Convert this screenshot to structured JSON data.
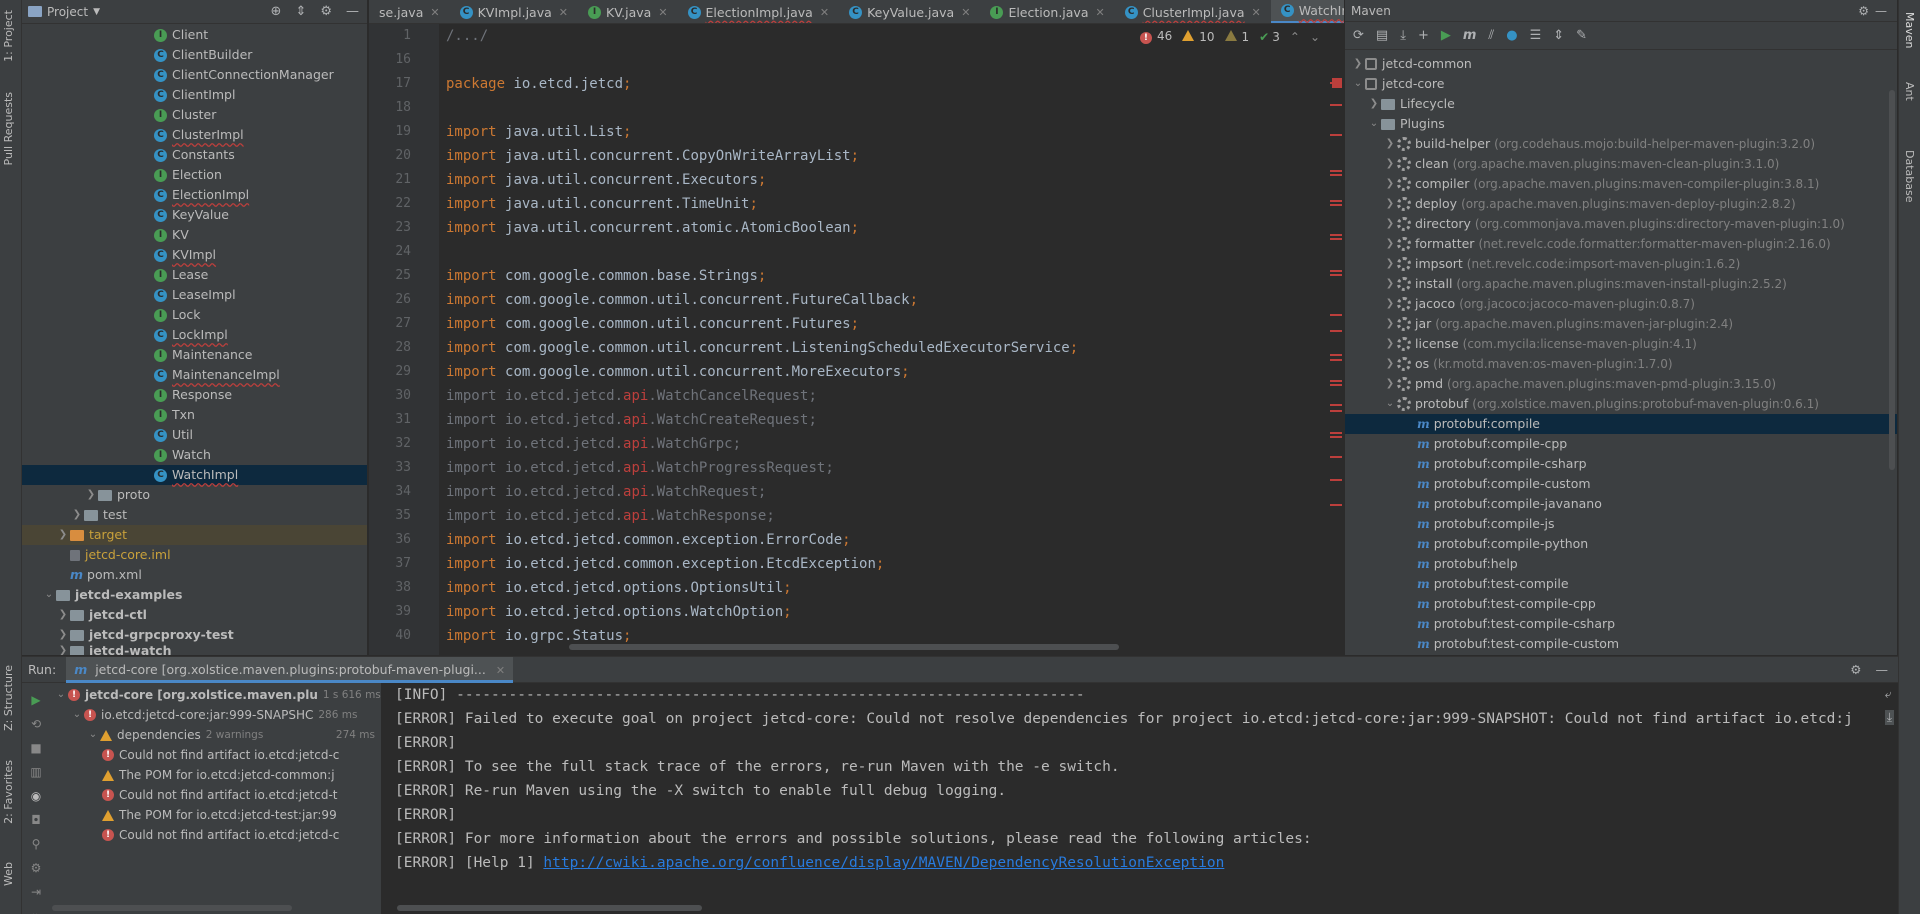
{
  "left_strip": {
    "project_tab": "1: Project",
    "pull_requests_tab": "Pull Requests",
    "structure_tab": "Z: Structure",
    "favorites_tab": "2: Favorites",
    "web_tab": "Web"
  },
  "project_panel": {
    "title": "Project",
    "classes": [
      {
        "name": "Client",
        "kind": "i",
        "error": false
      },
      {
        "name": "ClientBuilder",
        "kind": "c",
        "error": false
      },
      {
        "name": "ClientConnectionManager",
        "kind": "c",
        "error": false
      },
      {
        "name": "ClientImpl",
        "kind": "c",
        "error": false
      },
      {
        "name": "Cluster",
        "kind": "i",
        "error": false
      },
      {
        "name": "ClusterImpl",
        "kind": "c",
        "error": true
      },
      {
        "name": "Constants",
        "kind": "c",
        "error": false
      },
      {
        "name": "Election",
        "kind": "i",
        "error": false
      },
      {
        "name": "ElectionImpl",
        "kind": "c",
        "error": true
      },
      {
        "name": "KeyValue",
        "kind": "c",
        "error": false
      },
      {
        "name": "KV",
        "kind": "i",
        "error": false
      },
      {
        "name": "KVImpl",
        "kind": "c",
        "error": true
      },
      {
        "name": "Lease",
        "kind": "i",
        "error": false
      },
      {
        "name": "LeaseImpl",
        "kind": "c",
        "error": false
      },
      {
        "name": "Lock",
        "kind": "i",
        "error": false
      },
      {
        "name": "LockImpl",
        "kind": "c",
        "error": true
      },
      {
        "name": "Maintenance",
        "kind": "i",
        "error": false
      },
      {
        "name": "MaintenanceImpl",
        "kind": "c",
        "error": true
      },
      {
        "name": "Response",
        "kind": "i",
        "error": false
      },
      {
        "name": "Txn",
        "kind": "i",
        "error": false
      },
      {
        "name": "Util",
        "kind": "c",
        "error": false
      },
      {
        "name": "Watch",
        "kind": "i",
        "error": false
      },
      {
        "name": "WatchImpl",
        "kind": "c",
        "error": true
      }
    ],
    "proto": "proto",
    "test": "test",
    "target": "target",
    "iml": "jetcd-core.iml",
    "pom": "pom.xml",
    "examples": "jetcd-examples",
    "ctl": "jetcd-ctl",
    "grpcproxy": "jetcd-grpcproxy-test",
    "watch": "jetcd-watch"
  },
  "editor": {
    "tabs": [
      {
        "label": "se.java",
        "kind": "",
        "error": false,
        "active": false
      },
      {
        "label": "KVImpl.java",
        "kind": "c",
        "error": false,
        "active": false
      },
      {
        "label": "KV.java",
        "kind": "i",
        "error": false,
        "active": false
      },
      {
        "label": "ElectionImpl.java",
        "kind": "c",
        "error": true,
        "active": false
      },
      {
        "label": "KeyValue.java",
        "kind": "c",
        "error": false,
        "active": false
      },
      {
        "label": "Election.java",
        "kind": "i",
        "error": false,
        "active": false
      },
      {
        "label": "ClusterImpl.java",
        "kind": "c",
        "error": true,
        "active": false
      },
      {
        "label": "WatchImpl.java",
        "kind": "c",
        "error": true,
        "active": true
      }
    ],
    "inspection": {
      "errors": "46",
      "warnings": "10",
      "weak": "1",
      "ok": "3"
    },
    "lines": [
      {
        "n": "1",
        "parts": [
          [
            "dim",
            "/.../"
          ]
        ]
      },
      {
        "n": "16",
        "parts": []
      },
      {
        "n": "17",
        "parts": [
          [
            "kw",
            "package "
          ],
          [
            "",
            "io.etcd.jetcd"
          ],
          [
            "kw",
            ";"
          ]
        ]
      },
      {
        "n": "18",
        "parts": []
      },
      {
        "n": "19",
        "parts": [
          [
            "kw",
            "import "
          ],
          [
            "",
            "java.util.List"
          ],
          [
            "kw",
            ";"
          ]
        ]
      },
      {
        "n": "20",
        "parts": [
          [
            "kw",
            "import "
          ],
          [
            "",
            "java.util.concurrent.CopyOnWriteArrayList"
          ],
          [
            "kw",
            ";"
          ]
        ]
      },
      {
        "n": "21",
        "parts": [
          [
            "kw",
            "import "
          ],
          [
            "",
            "java.util.concurrent.Executors"
          ],
          [
            "kw",
            ";"
          ]
        ]
      },
      {
        "n": "22",
        "parts": [
          [
            "kw",
            "import "
          ],
          [
            "",
            "java.util.concurrent.TimeUnit"
          ],
          [
            "kw",
            ";"
          ]
        ]
      },
      {
        "n": "23",
        "parts": [
          [
            "kw",
            "import "
          ],
          [
            "",
            "java.util.concurrent.atomic.AtomicBoolean"
          ],
          [
            "kw",
            ";"
          ]
        ]
      },
      {
        "n": "24",
        "parts": []
      },
      {
        "n": "25",
        "parts": [
          [
            "kw",
            "import "
          ],
          [
            "",
            "com.google.common.base.Strings"
          ],
          [
            "kw",
            ";"
          ]
        ]
      },
      {
        "n": "26",
        "parts": [
          [
            "kw",
            "import "
          ],
          [
            "",
            "com.google.common.util.concurrent.FutureCallback"
          ],
          [
            "kw",
            ";"
          ]
        ]
      },
      {
        "n": "27",
        "parts": [
          [
            "kw",
            "import "
          ],
          [
            "",
            "com.google.common.util.concurrent.Futures"
          ],
          [
            "kw",
            ";"
          ]
        ]
      },
      {
        "n": "28",
        "parts": [
          [
            "kw",
            "import "
          ],
          [
            "",
            "com.google.common.util.concurrent.ListeningScheduledExecutorService"
          ],
          [
            "kw",
            ";"
          ]
        ]
      },
      {
        "n": "29",
        "parts": [
          [
            "kw",
            "import "
          ],
          [
            "",
            "com.google.common.util.concurrent.MoreExecutors"
          ],
          [
            "kw",
            ";"
          ]
        ]
      },
      {
        "n": "30",
        "parts": [
          [
            "dim",
            "import io.etcd.jetcd."
          ],
          [
            "red",
            "api"
          ],
          [
            "dim",
            ".WatchCancelRequest;"
          ]
        ]
      },
      {
        "n": "31",
        "parts": [
          [
            "dim",
            "import io.etcd.jetcd."
          ],
          [
            "red",
            "api"
          ],
          [
            "dim",
            ".WatchCreateRequest;"
          ]
        ]
      },
      {
        "n": "32",
        "parts": [
          [
            "dim",
            "import io.etcd.jetcd."
          ],
          [
            "red",
            "api"
          ],
          [
            "dim",
            ".WatchGrpc;"
          ]
        ]
      },
      {
        "n": "33",
        "parts": [
          [
            "dim",
            "import io.etcd.jetcd."
          ],
          [
            "red",
            "api"
          ],
          [
            "dim",
            ".WatchProgressRequest;"
          ]
        ]
      },
      {
        "n": "34",
        "parts": [
          [
            "dim",
            "import io.etcd.jetcd."
          ],
          [
            "red",
            "api"
          ],
          [
            "dim",
            ".WatchRequest;"
          ]
        ]
      },
      {
        "n": "35",
        "parts": [
          [
            "dim",
            "import io.etcd.jetcd."
          ],
          [
            "red",
            "api"
          ],
          [
            "dim",
            ".WatchResponse;"
          ]
        ]
      },
      {
        "n": "36",
        "parts": [
          [
            "kw",
            "import "
          ],
          [
            "",
            "io.etcd.jetcd.common.exception.ErrorCode"
          ],
          [
            "kw",
            ";"
          ]
        ]
      },
      {
        "n": "37",
        "parts": [
          [
            "kw",
            "import "
          ],
          [
            "",
            "io.etcd.jetcd.common.exception.EtcdException"
          ],
          [
            "kw",
            ";"
          ]
        ]
      },
      {
        "n": "38",
        "parts": [
          [
            "kw",
            "import "
          ],
          [
            "",
            "io.etcd.jetcd.options.OptionsUtil"
          ],
          [
            "kw",
            ";"
          ]
        ]
      },
      {
        "n": "39",
        "parts": [
          [
            "kw",
            "import "
          ],
          [
            "",
            "io.etcd.jetcd.options.WatchOption"
          ],
          [
            "kw",
            ";"
          ]
        ]
      },
      {
        "n": "40",
        "parts": [
          [
            "kw",
            "import "
          ],
          [
            "",
            "io.grpc.Status"
          ],
          [
            "kw",
            ";"
          ]
        ]
      }
    ]
  },
  "maven": {
    "title": "Maven",
    "common": "jetcd-common",
    "core": "jetcd-core",
    "lifecycle": "Lifecycle",
    "plugins_label": "Plugins",
    "plugins": [
      {
        "name": "build-helper",
        "coord": "(org.codehaus.mojo:build-helper-maven-plugin:3.2.0)"
      },
      {
        "name": "clean",
        "coord": "(org.apache.maven.plugins:maven-clean-plugin:3.1.0)"
      },
      {
        "name": "compiler",
        "coord": "(org.apache.maven.plugins:maven-compiler-plugin:3.8.1)"
      },
      {
        "name": "deploy",
        "coord": "(org.apache.maven.plugins:maven-deploy-plugin:2.8.2)"
      },
      {
        "name": "directory",
        "coord": "(org.commonjava.maven.plugins:directory-maven-plugin:1.0)"
      },
      {
        "name": "formatter",
        "coord": "(net.revelc.code.formatter:formatter-maven-plugin:2.16.0)"
      },
      {
        "name": "impsort",
        "coord": "(net.revelc.code:impsort-maven-plugin:1.6.2)"
      },
      {
        "name": "install",
        "coord": "(org.apache.maven.plugins:maven-install-plugin:2.5.2)"
      },
      {
        "name": "jacoco",
        "coord": "(org.jacoco:jacoco-maven-plugin:0.8.7)"
      },
      {
        "name": "jar",
        "coord": "(org.apache.maven.plugins:maven-jar-plugin:2.4)"
      },
      {
        "name": "license",
        "coord": "(com.mycila:license-maven-plugin:4.1)"
      },
      {
        "name": "os",
        "coord": "(kr.motd.maven:os-maven-plugin:1.7.0)"
      },
      {
        "name": "pmd",
        "coord": "(org.apache.maven.plugins:maven-pmd-plugin:3.15.0)"
      },
      {
        "name": "protobuf",
        "coord": "(org.xolstice.maven.plugins:protobuf-maven-plugin:0.6.1)"
      }
    ],
    "goals": [
      "protobuf:compile",
      "protobuf:compile-cpp",
      "protobuf:compile-csharp",
      "protobuf:compile-custom",
      "protobuf:compile-javanano",
      "protobuf:compile-js",
      "protobuf:compile-python",
      "protobuf:help",
      "protobuf:test-compile",
      "protobuf:test-compile-cpp",
      "protobuf:test-compile-csharp",
      "protobuf:test-compile-custom"
    ],
    "selected_goal": "protobuf:compile"
  },
  "right_strip": {
    "maven_tab": "Maven",
    "ant_tab": "Ant",
    "database_tab": "Database"
  },
  "run": {
    "label": "Run:",
    "tab": "jetcd-core [org.xolstice.maven.plugins:protobuf-maven-plugi...",
    "tree": [
      {
        "indent": 0,
        "icon": "err",
        "text": "jetcd-core [org.xolstice.maven.plu",
        "meta": "1 s 616 ms",
        "bold": true
      },
      {
        "indent": 1,
        "icon": "err",
        "text": "io.etcd:jetcd-core:jar:999-SNAPSHC",
        "meta": "286 ms",
        "bold": false
      },
      {
        "indent": 2,
        "icon": "warn",
        "text": "dependencies",
        "meta": "2 warnings",
        "bold": false,
        "meta_right": "274 ms"
      },
      {
        "indent": 3,
        "icon": "err",
        "text": "Could not find artifact io.etcd:jetcd-c",
        "meta": "",
        "bold": false
      },
      {
        "indent": 3,
        "icon": "warn",
        "text": "The POM for io.etcd:jetcd-common:j",
        "meta": "",
        "bold": false
      },
      {
        "indent": 3,
        "icon": "err",
        "text": "Could not find artifact io.etcd:jetcd-t",
        "meta": "",
        "bold": false
      },
      {
        "indent": 3,
        "icon": "warn",
        "text": "The POM for io.etcd:jetcd-test:jar:99",
        "meta": "",
        "bold": false
      },
      {
        "indent": 3,
        "icon": "err",
        "text": "Could not find artifact io.etcd:jetcd-c",
        "meta": "",
        "bold": false
      }
    ],
    "console": [
      "[INFO] ------------------------------------------------------------------------",
      "[ERROR] Failed to execute goal on project jetcd-core: Could not resolve dependencies for project io.etcd:jetcd-core:jar:999-SNAPSHOT: Could not find artifact io.etcd:j",
      "[ERROR]",
      "[ERROR] To see the full stack trace of the errors, re-run Maven with the -e switch.",
      "[ERROR] Re-run Maven using the -X switch to enable full debug logging.",
      "[ERROR]",
      "[ERROR] For more information about the errors and possible solutions, please read the following articles:"
    ],
    "help_prefix": "[ERROR] [Help 1] ",
    "help_link": "http://cwiki.apache.org/confluence/display/MAVEN/DependencyResolutionException"
  }
}
